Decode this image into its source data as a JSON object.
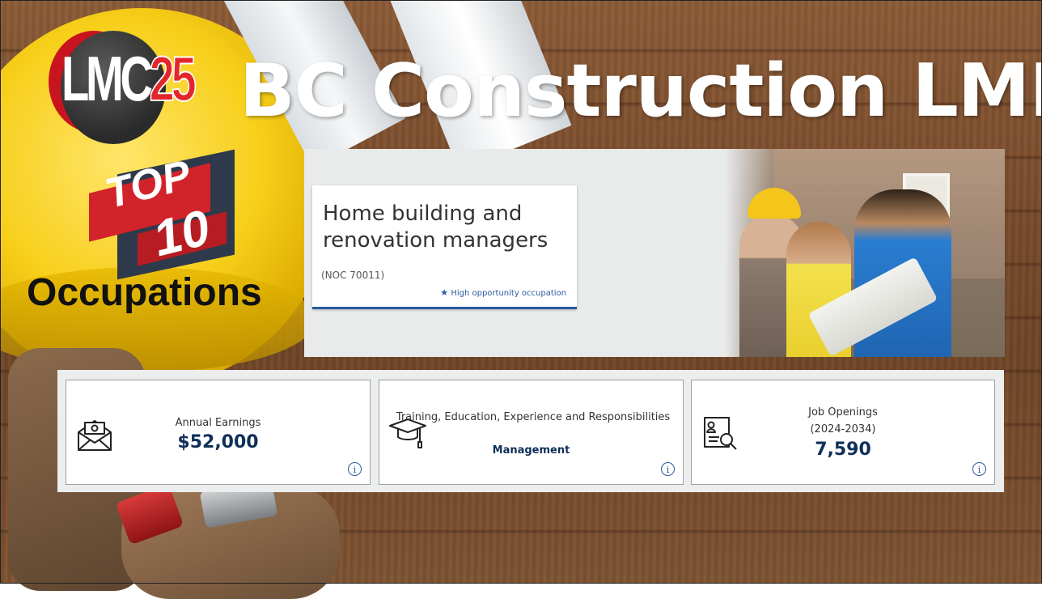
{
  "header": {
    "logo_prefix": "LMC",
    "logo_number": "25",
    "title": "BC Construction LMI"
  },
  "badge": {
    "top_word": "TOP",
    "top_number": "10",
    "caption": "Occupations"
  },
  "occupation": {
    "title": "Home building and renovation managers",
    "noc": "(NOC 70011)",
    "flag": "High opportunity occupation"
  },
  "stats": [
    {
      "label": "Annual Earnings",
      "value": "$52,000",
      "icon": "money-envelope-icon"
    },
    {
      "label": "Training, Education, Experience and Responsibilities",
      "value": "Management",
      "icon": "graduation-cap-icon"
    },
    {
      "label": "Job Openings",
      "sublabel": "(2024-2034)",
      "value": "7,590",
      "icon": "job-search-document-icon"
    }
  ],
  "colors": {
    "accent_blue": "#2a5a9e",
    "value_navy": "#0e2f57",
    "logo_red": "#e3262b",
    "hat_yellow": "#f7cf1a"
  }
}
